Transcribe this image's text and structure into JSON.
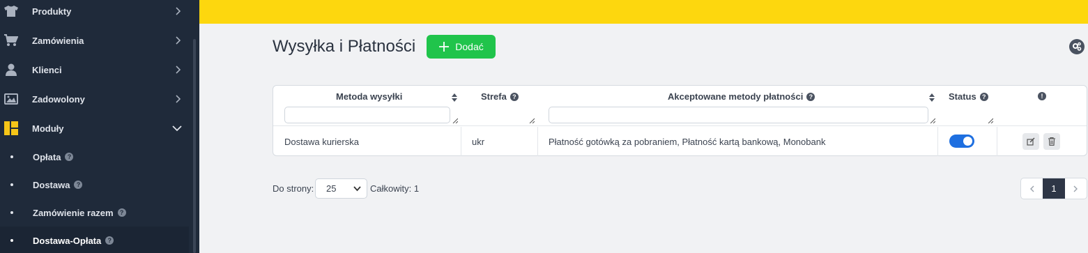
{
  "sidebar": {
    "items": [
      {
        "label": "Produkty",
        "icon": "tshirt-icon"
      },
      {
        "label": "Zamówienia",
        "icon": "cart-icon"
      },
      {
        "label": "Klienci",
        "icon": "user-icon"
      },
      {
        "label": "Zadowolony",
        "icon": "image-icon"
      },
      {
        "label": "Moduły",
        "icon": "modules-icon"
      }
    ],
    "subitems": [
      {
        "label": "Opłata"
      },
      {
        "label": "Dostawa"
      },
      {
        "label": "Zamówienie razem"
      },
      {
        "label": "Dostawa-Opłata"
      }
    ]
  },
  "header": {
    "title": "Wysyłka i Płatności",
    "add_label": "Dodać"
  },
  "table": {
    "columns": [
      {
        "label": "Metoda wysyłki"
      },
      {
        "label": "Strefa"
      },
      {
        "label": "Akceptowane metody płatności"
      },
      {
        "label": "Status"
      }
    ],
    "rows": [
      {
        "method": "Dostawa kurierska",
        "zone": "ukr",
        "payments": "Płatność gotówką za pobraniem, Płatność kartą bankową, Monobank",
        "status_on": true
      }
    ]
  },
  "footer": {
    "per_page_label": "Do strony:",
    "per_page_value": "25",
    "total_label": "Całkowity: 1",
    "current_page": "1"
  },
  "colors": {
    "topbar": "#fdd70e",
    "sidebar": "#1f2a3a",
    "add_button": "#20c44b",
    "toggle": "#1e6fe0"
  }
}
